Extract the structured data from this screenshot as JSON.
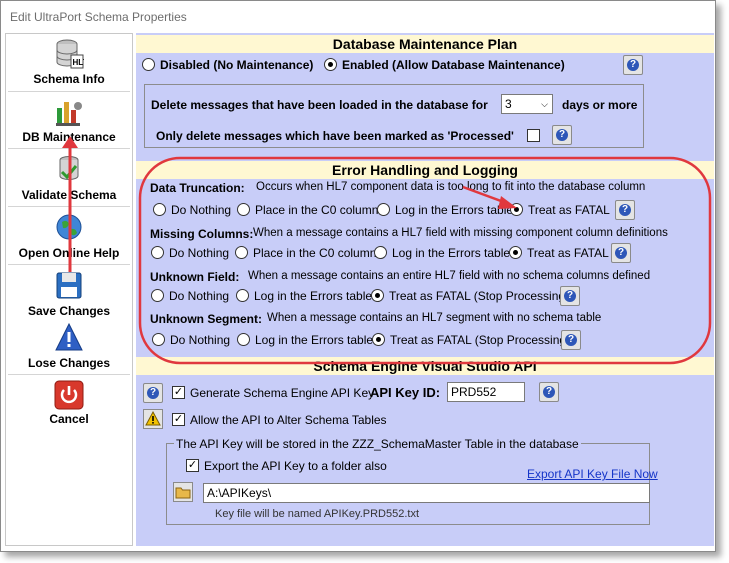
{
  "window": {
    "title": "Edit UltraPort Schema Properties"
  },
  "sidebar": {
    "items": [
      {
        "label": "Schema Info",
        "icon": "database-icon"
      },
      {
        "label": "DB Maintenance",
        "icon": "db-maintenance-icon"
      },
      {
        "label": "Validate Schema",
        "icon": "validate-icon"
      },
      {
        "label": "Open Online Help",
        "icon": "globe-icon"
      },
      {
        "label": "Save Changes",
        "icon": "floppy-icon"
      },
      {
        "label": "Lose Changes",
        "icon": "warning-icon"
      },
      {
        "label": "Cancel",
        "icon": "power-icon"
      }
    ]
  },
  "maintenance": {
    "header": "Database Maintenance Plan",
    "disabled_label": "Disabled (No Maintenance)",
    "enabled_label": "Enabled (Allow Database Maintenance)",
    "selected": "enabled",
    "delete_prefix": "Delete messages that have been loaded in the database for",
    "days_value": "3",
    "days_suffix": "days or more",
    "processed_label": "Only delete messages which have been marked as 'Processed'",
    "processed_checked": false
  },
  "errors": {
    "header": "Error Handling and Logging",
    "sections": [
      {
        "title": "Data Truncation:",
        "desc": "Occurs when HL7 component data is too long to fit into the database column",
        "options": [
          "Do Nothing",
          "Place in the C0 column",
          "Log in the Errors table",
          "Treat as FATAL"
        ],
        "selected": 3
      },
      {
        "title": "Missing Columns:",
        "desc": "When a message contains a HL7 field with missing component column definitions",
        "options": [
          "Do Nothing",
          "Place in the C0 column",
          "Log in the Errors table",
          "Treat as FATAL"
        ],
        "selected": 3
      },
      {
        "title": "Unknown Field:",
        "desc": "When a  message contains an entire HL7 field with no schema columns defined",
        "options": [
          "Do Nothing",
          "Log in the Errors table",
          "Treat as FATAL (Stop Processing)"
        ],
        "selected": 2
      },
      {
        "title": "Unknown Segment:",
        "desc": "When a message contains an HL7 segment with no schema table",
        "options": [
          "Do Nothing",
          "Log in the Errors table",
          "Treat as FATAL (Stop Processing)"
        ],
        "selected": 2
      }
    ]
  },
  "api": {
    "header": "Schema Engine Visual Studio API",
    "generate_label": "Generate Schema Engine API Key",
    "generate_checked": true,
    "key_label": "API Key ID:",
    "key_value": "PRD552",
    "alter_label": "Allow the API to Alter Schema Tables",
    "alter_checked": true,
    "group_title": "The API Key will be stored in the ZZZ_SchemaMaster Table in the database",
    "export_label": "Export the API Key to a folder also",
    "export_checked": true,
    "export_link": "Export API Key File Now",
    "folder_value": "A:\\APIKeys\\",
    "key_file_note": "Key file will be named APIKey.PRD552.txt"
  },
  "colors": {
    "panel": "#c8cdf8",
    "header": "#fff8d2",
    "annotation": "#e0383e",
    "link": "#1535c8"
  }
}
